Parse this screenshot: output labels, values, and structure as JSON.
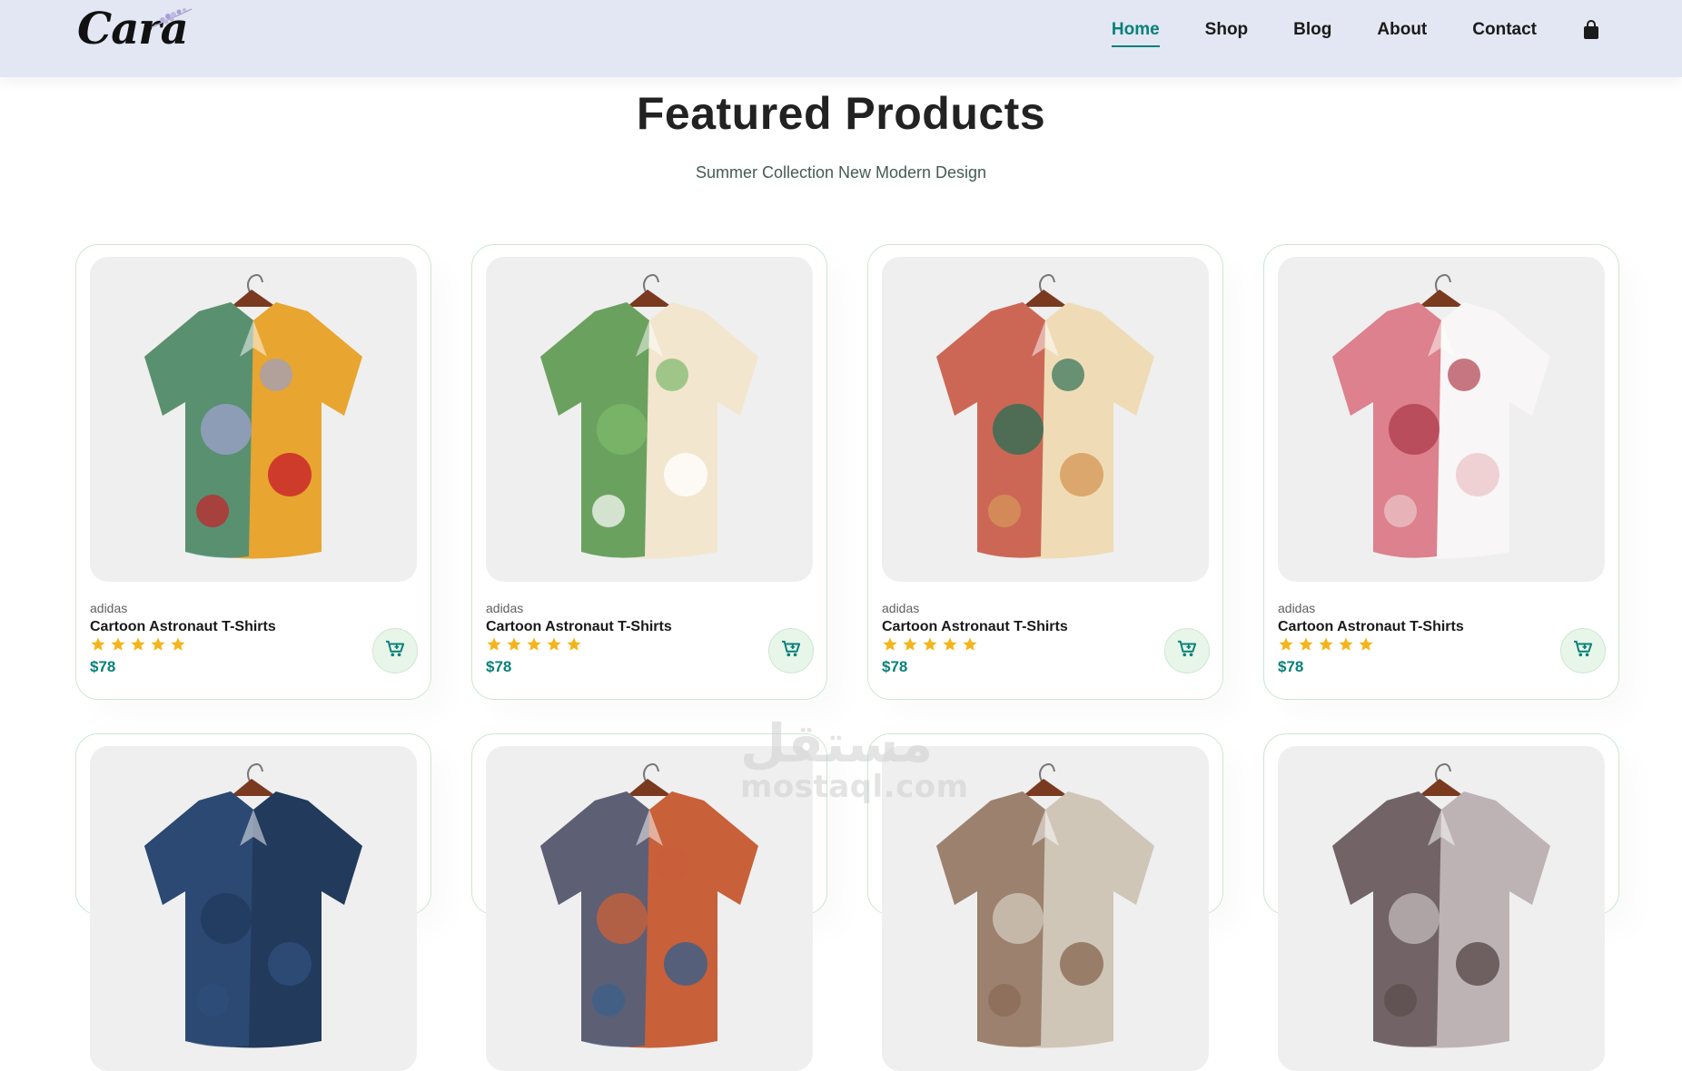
{
  "header": {
    "logo_text": "Cara",
    "nav": [
      {
        "label": "Home",
        "active": true
      },
      {
        "label": "Shop",
        "active": false
      },
      {
        "label": "Blog",
        "active": false
      },
      {
        "label": "About",
        "active": false
      },
      {
        "label": "Contact",
        "active": false
      }
    ],
    "bag_icon": "shopping-bag-icon"
  },
  "section": {
    "title": "Featured Products",
    "subtitle": "Summer Collection New Modern Design"
  },
  "products": [
    {
      "brand": "adidas",
      "name": "Cartoon Astronaut T-Shirts",
      "rating": 5,
      "price": "$78",
      "shirt_colors": [
        "#e8a530",
        "#2a8a86",
        "#9aa0c8",
        "#c8202a"
      ]
    },
    {
      "brand": "adidas",
      "name": "Cartoon Astronaut T-Shirts",
      "rating": 5,
      "price": "$78",
      "shirt_colors": [
        "#f2e6cf",
        "#3e8a3a",
        "#7cb86a",
        "#ffffff"
      ]
    },
    {
      "brand": "adidas",
      "name": "Cartoon Astronaut T-Shirts",
      "rating": 5,
      "price": "$78",
      "shirt_colors": [
        "#efdcb6",
        "#c04035",
        "#2f6f55",
        "#d79a5a"
      ]
    },
    {
      "brand": "adidas",
      "name": "Cartoon Astronaut T-Shirts",
      "rating": 5,
      "price": "$78",
      "shirt_colors": [
        "#f8f6f6",
        "#d35a6a",
        "#b04050",
        "#ecc8cc"
      ]
    }
  ],
  "products_row2": [
    {
      "shirt_colors": [
        "#223a5c",
        "#2f4f7a"
      ]
    },
    {
      "shirt_colors": [
        "#c8603a",
        "#3a5f8a"
      ]
    },
    {
      "shirt_colors": [
        "#cfc6b8",
        "#8a6a55"
      ]
    },
    {
      "shirt_colors": [
        "#bdb3b5",
        "#5a4a4c"
      ]
    }
  ],
  "watermark": {
    "arabic": "مستقل",
    "latin": "mostaql.com"
  },
  "colors": {
    "accent": "#088178",
    "header_bg": "#e3e6f3",
    "star": "#f3b519",
    "card_border": "#cce7d0"
  }
}
